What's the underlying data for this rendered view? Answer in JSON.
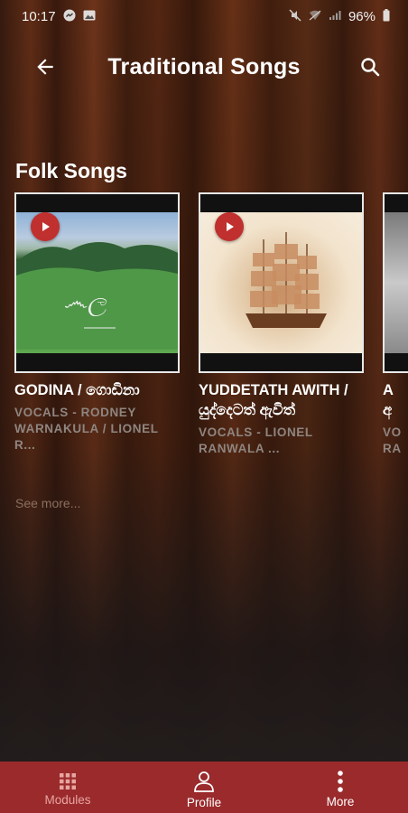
{
  "status_bar": {
    "time": "10:17",
    "battery": "96%"
  },
  "header": {
    "title": "Traditional Songs"
  },
  "section": {
    "title": "Folk Songs",
    "see_more": "See more..."
  },
  "cards": [
    {
      "title": "GODINA / ගොඩිනා",
      "subtitle": "VOCALS -  RODNEY WARNAKULA / LIONEL R..."
    },
    {
      "title": "YUDDETATH AWITH / යුද්දෙටත් ඇවිත්",
      "subtitle": "VOCALS - LIONEL RANWALA ..."
    },
    {
      "title": "A",
      "title_line2": "අ",
      "subtitle": "VO",
      "subtitle_line2": "RA"
    }
  ],
  "bottom_nav": {
    "modules": "Modules",
    "profile": "Profile",
    "more": "More"
  },
  "colors": {
    "accent_red": "#c0302e",
    "nav_background": "#9a2a2c",
    "nav_active": "#e8a5a0"
  }
}
